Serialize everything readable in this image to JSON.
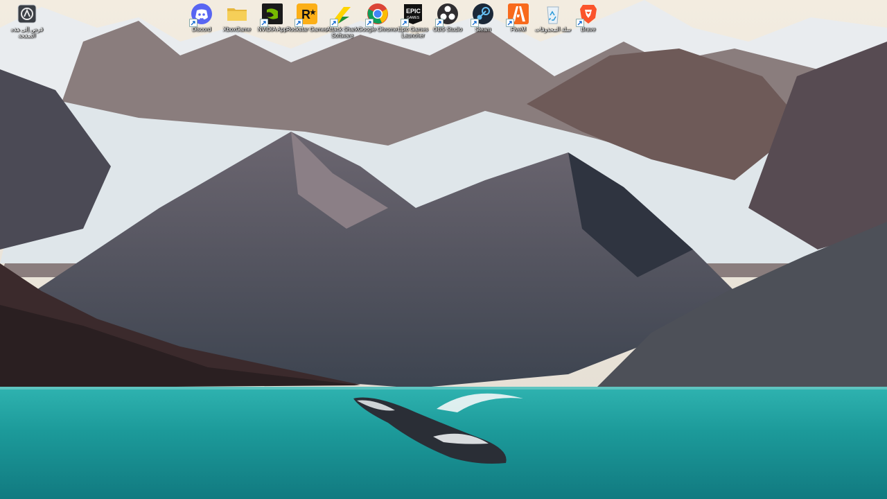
{
  "desktop": {
    "icons": [
      {
        "label": "قرص إلى هذه الصفحة",
        "icon": "tile-icon"
      },
      {
        "label": "Discord",
        "icon": "discord-icon"
      },
      {
        "label": "XboxGame",
        "icon": "folder-icon"
      },
      {
        "label": "NVIDIA App",
        "icon": "nvidia-icon"
      },
      {
        "label": "Rockstar Games",
        "icon": "rockstar-icon"
      },
      {
        "label": "Attack Shark Software",
        "icon": "attack-shark-icon"
      },
      {
        "label": "Google Chrome",
        "icon": "chrome-icon"
      },
      {
        "label": "Epic Games Launcher",
        "icon": "epic-games-icon",
        "badge": "EPIC GAMES"
      },
      {
        "label": "OBS Studio",
        "icon": "obs-icon"
      },
      {
        "label": "Steam",
        "icon": "steam-icon"
      },
      {
        "label": "FiveM",
        "icon": "fivem-icon"
      },
      {
        "label": "سلة المحذوفات",
        "icon": "recycle-bin-icon"
      },
      {
        "label": "Brave",
        "icon": "brave-icon"
      }
    ]
  },
  "wallpaper": {
    "subject": "mountains-glacier-whale",
    "colors": {
      "sky": "#efe6d6",
      "water": "#1a9fa0",
      "rock": "#5a4a48"
    }
  }
}
